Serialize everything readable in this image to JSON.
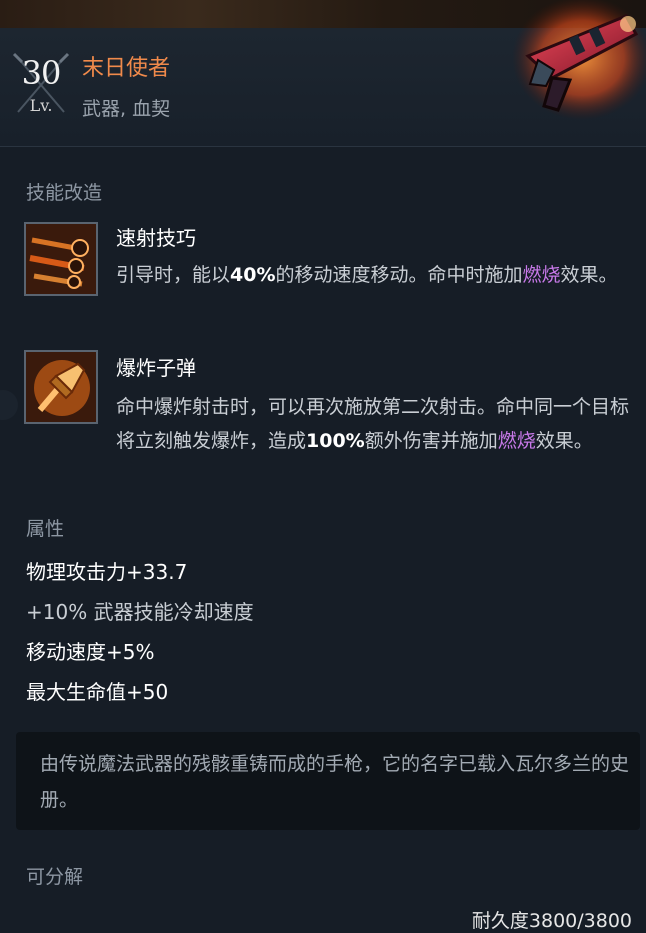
{
  "item": {
    "level": "30",
    "level_label": "Lv.",
    "name": "末日使者",
    "type": "武器, 血契",
    "weapon_icon": "flaming-pistol-icon"
  },
  "skills": {
    "title": "技能改造",
    "items": [
      {
        "name": "速射技巧",
        "icon": "rapid-fire-icon",
        "desc_1": "引导时，能以",
        "desc_bold": "40%",
        "desc_2": "的移动速度移动。命中时施加",
        "desc_keyword": "燃烧",
        "desc_3": "效果。"
      },
      {
        "name": "爆炸子弹",
        "icon": "explosive-bullet-icon",
        "desc_1": "命中爆炸射击时，可以再次施放第二次射击。命中同一个目标将立刻触发爆炸，造成",
        "desc_bold": "100%",
        "desc_2": "额外伤害并施加",
        "desc_keyword": "燃烧",
        "desc_3": "效果。"
      }
    ]
  },
  "attributes": {
    "title": "属性",
    "items": [
      "物理攻击力+33.7",
      "+10% 武器技能冷却速度",
      "移动速度+5%",
      "最大生命值+50"
    ]
  },
  "lore": "由传说魔法武器的残骸重铸而成的手枪，它的名字已载入瓦尔多兰的史册。",
  "footer": {
    "salvage": "可分解",
    "durability": "耐久度3800/3800"
  },
  "colors": {
    "item_name": "#f08a4b",
    "keyword": "#c779e8",
    "background": "#161d26"
  }
}
